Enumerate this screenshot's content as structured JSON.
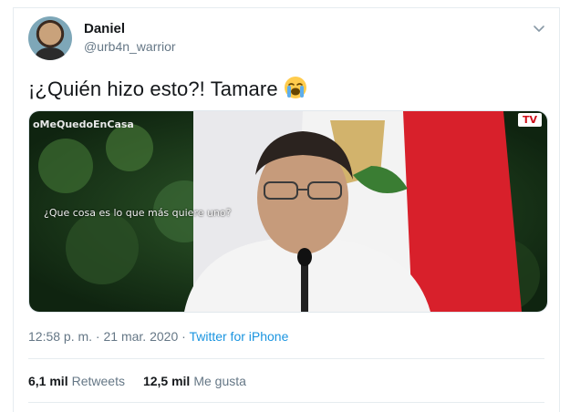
{
  "tweet": {
    "display_name": "Daniel",
    "handle": "@urb4n_warrior",
    "text": "¡¿Quién hizo esto?! Tamare",
    "emoji": "loudly-crying-face"
  },
  "media": {
    "hashtag": "oMeQuedoEnCasa",
    "subtitle": "¿Que cosa es lo que más quiere uno?",
    "channel_logo": "TV"
  },
  "meta": {
    "time": "12:58 p. m.",
    "separator": " · ",
    "date": "21 mar. 2020",
    "source": "Twitter for iPhone"
  },
  "stats": {
    "retweets_count": "6,1 mil",
    "retweets_label": "Retweets",
    "likes_count": "12,5 mil",
    "likes_label": "Me gusta"
  },
  "colors": {
    "link": "#1b95e0",
    "secondary_text": "#657786",
    "primary_text": "#14171a",
    "divider": "#e6ecf0"
  }
}
